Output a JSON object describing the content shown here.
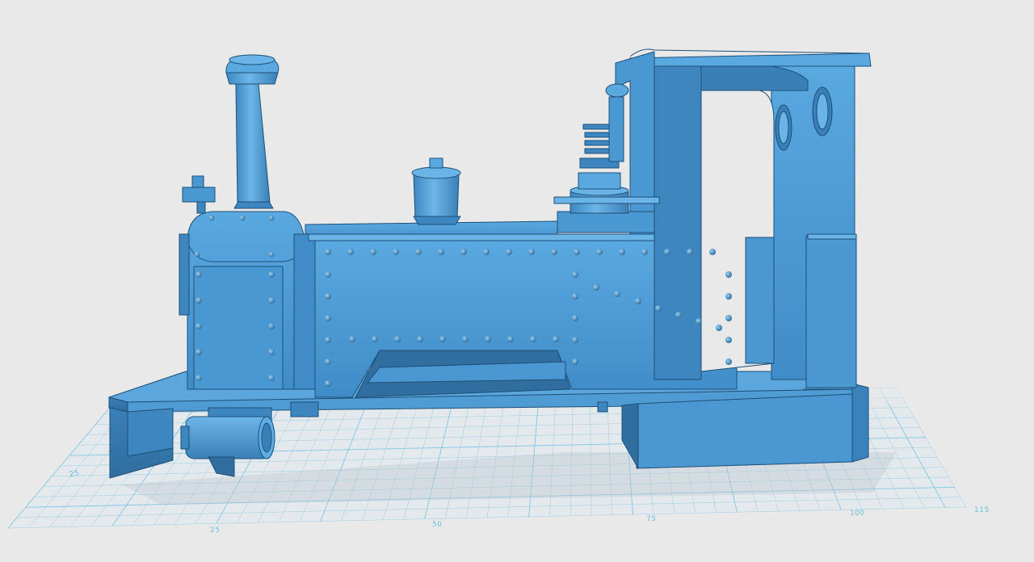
{
  "viewport": {
    "background": "#e9e9e9",
    "model_color": "#4a9ad6",
    "grid_color": "#5fb8df",
    "model_name_icon": "steam-locomotive-model"
  },
  "grid_labels": {
    "side_25": "25",
    "front_25": "25",
    "front_50": "50",
    "front_75": "75",
    "front_100": "100",
    "front_115": "115"
  }
}
